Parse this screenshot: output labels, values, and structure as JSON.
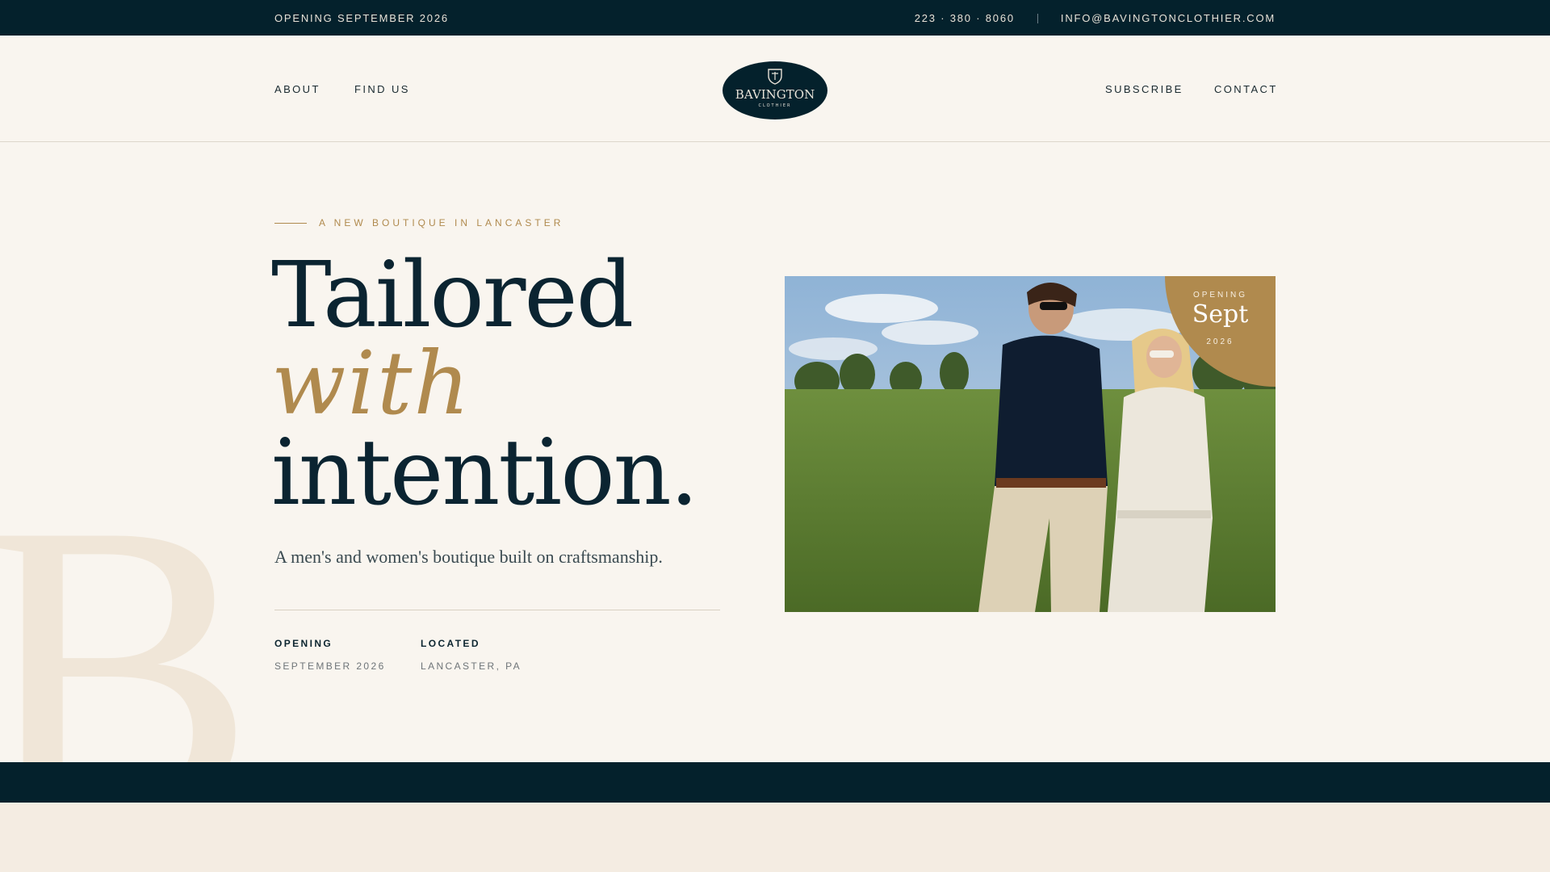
{
  "topbar": {
    "announcement": "OPENING SEPTEMBER 2026",
    "phone": "223 · 380 · 8060",
    "email": "INFO@BAVINGTONCLOTHIER.COM"
  },
  "nav": {
    "left": [
      "ABOUT",
      "FIND US"
    ],
    "right": [
      "SUBSCRIBE",
      "CONTACT"
    ],
    "logo": {
      "name": "BAVINGTON",
      "tagline": "CLOTHIER"
    }
  },
  "hero": {
    "eyebrow": "A NEW BOUTIQUE IN LANCASTER",
    "headline": [
      "Tailored",
      "with",
      "intention."
    ],
    "subtitle": "A men's and women's boutique built on craftsmanship.",
    "meta": [
      {
        "label": "OPENING",
        "value": "SEPTEMBER 2026"
      },
      {
        "label": "LOCATED",
        "value": "LANCASTER, PA"
      }
    ],
    "watermark": "B"
  },
  "badge": {
    "top": "OPENING",
    "month": "Sept",
    "year": "2026"
  },
  "colors": {
    "navy": "#04212c",
    "gold": "#b08a4e",
    "cream": "#f9f5ef"
  },
  "photo": {
    "alt_icon": "couple-walking-photo"
  }
}
